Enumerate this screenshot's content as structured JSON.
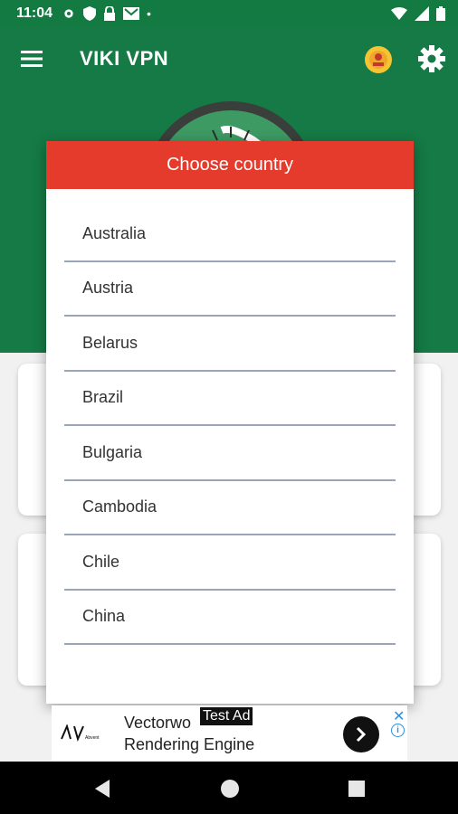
{
  "status_bar": {
    "time": "11:04"
  },
  "app_bar": {
    "title": "VIKI VPN"
  },
  "dialog": {
    "title": "Choose country",
    "countries": [
      "Australia",
      "Austria",
      "Belarus",
      "Brazil",
      "Bulgaria",
      "Cambodia",
      "Chile",
      "China"
    ]
  },
  "ad": {
    "badge": "Test Ad",
    "logo_text": "Abvent",
    "line1": "Vectorwo",
    "line2": "Rendering Engine"
  },
  "colors": {
    "primary_green": "#157a45",
    "dialog_header": "#e53b2c",
    "divider": "#9aa6b8"
  },
  "icons": {
    "menu": "hamburger-icon",
    "premium": "premium-badge-icon",
    "settings": "gear-icon",
    "back": "back-triangle-icon",
    "home": "home-circle-icon",
    "recents": "recents-square-icon"
  }
}
